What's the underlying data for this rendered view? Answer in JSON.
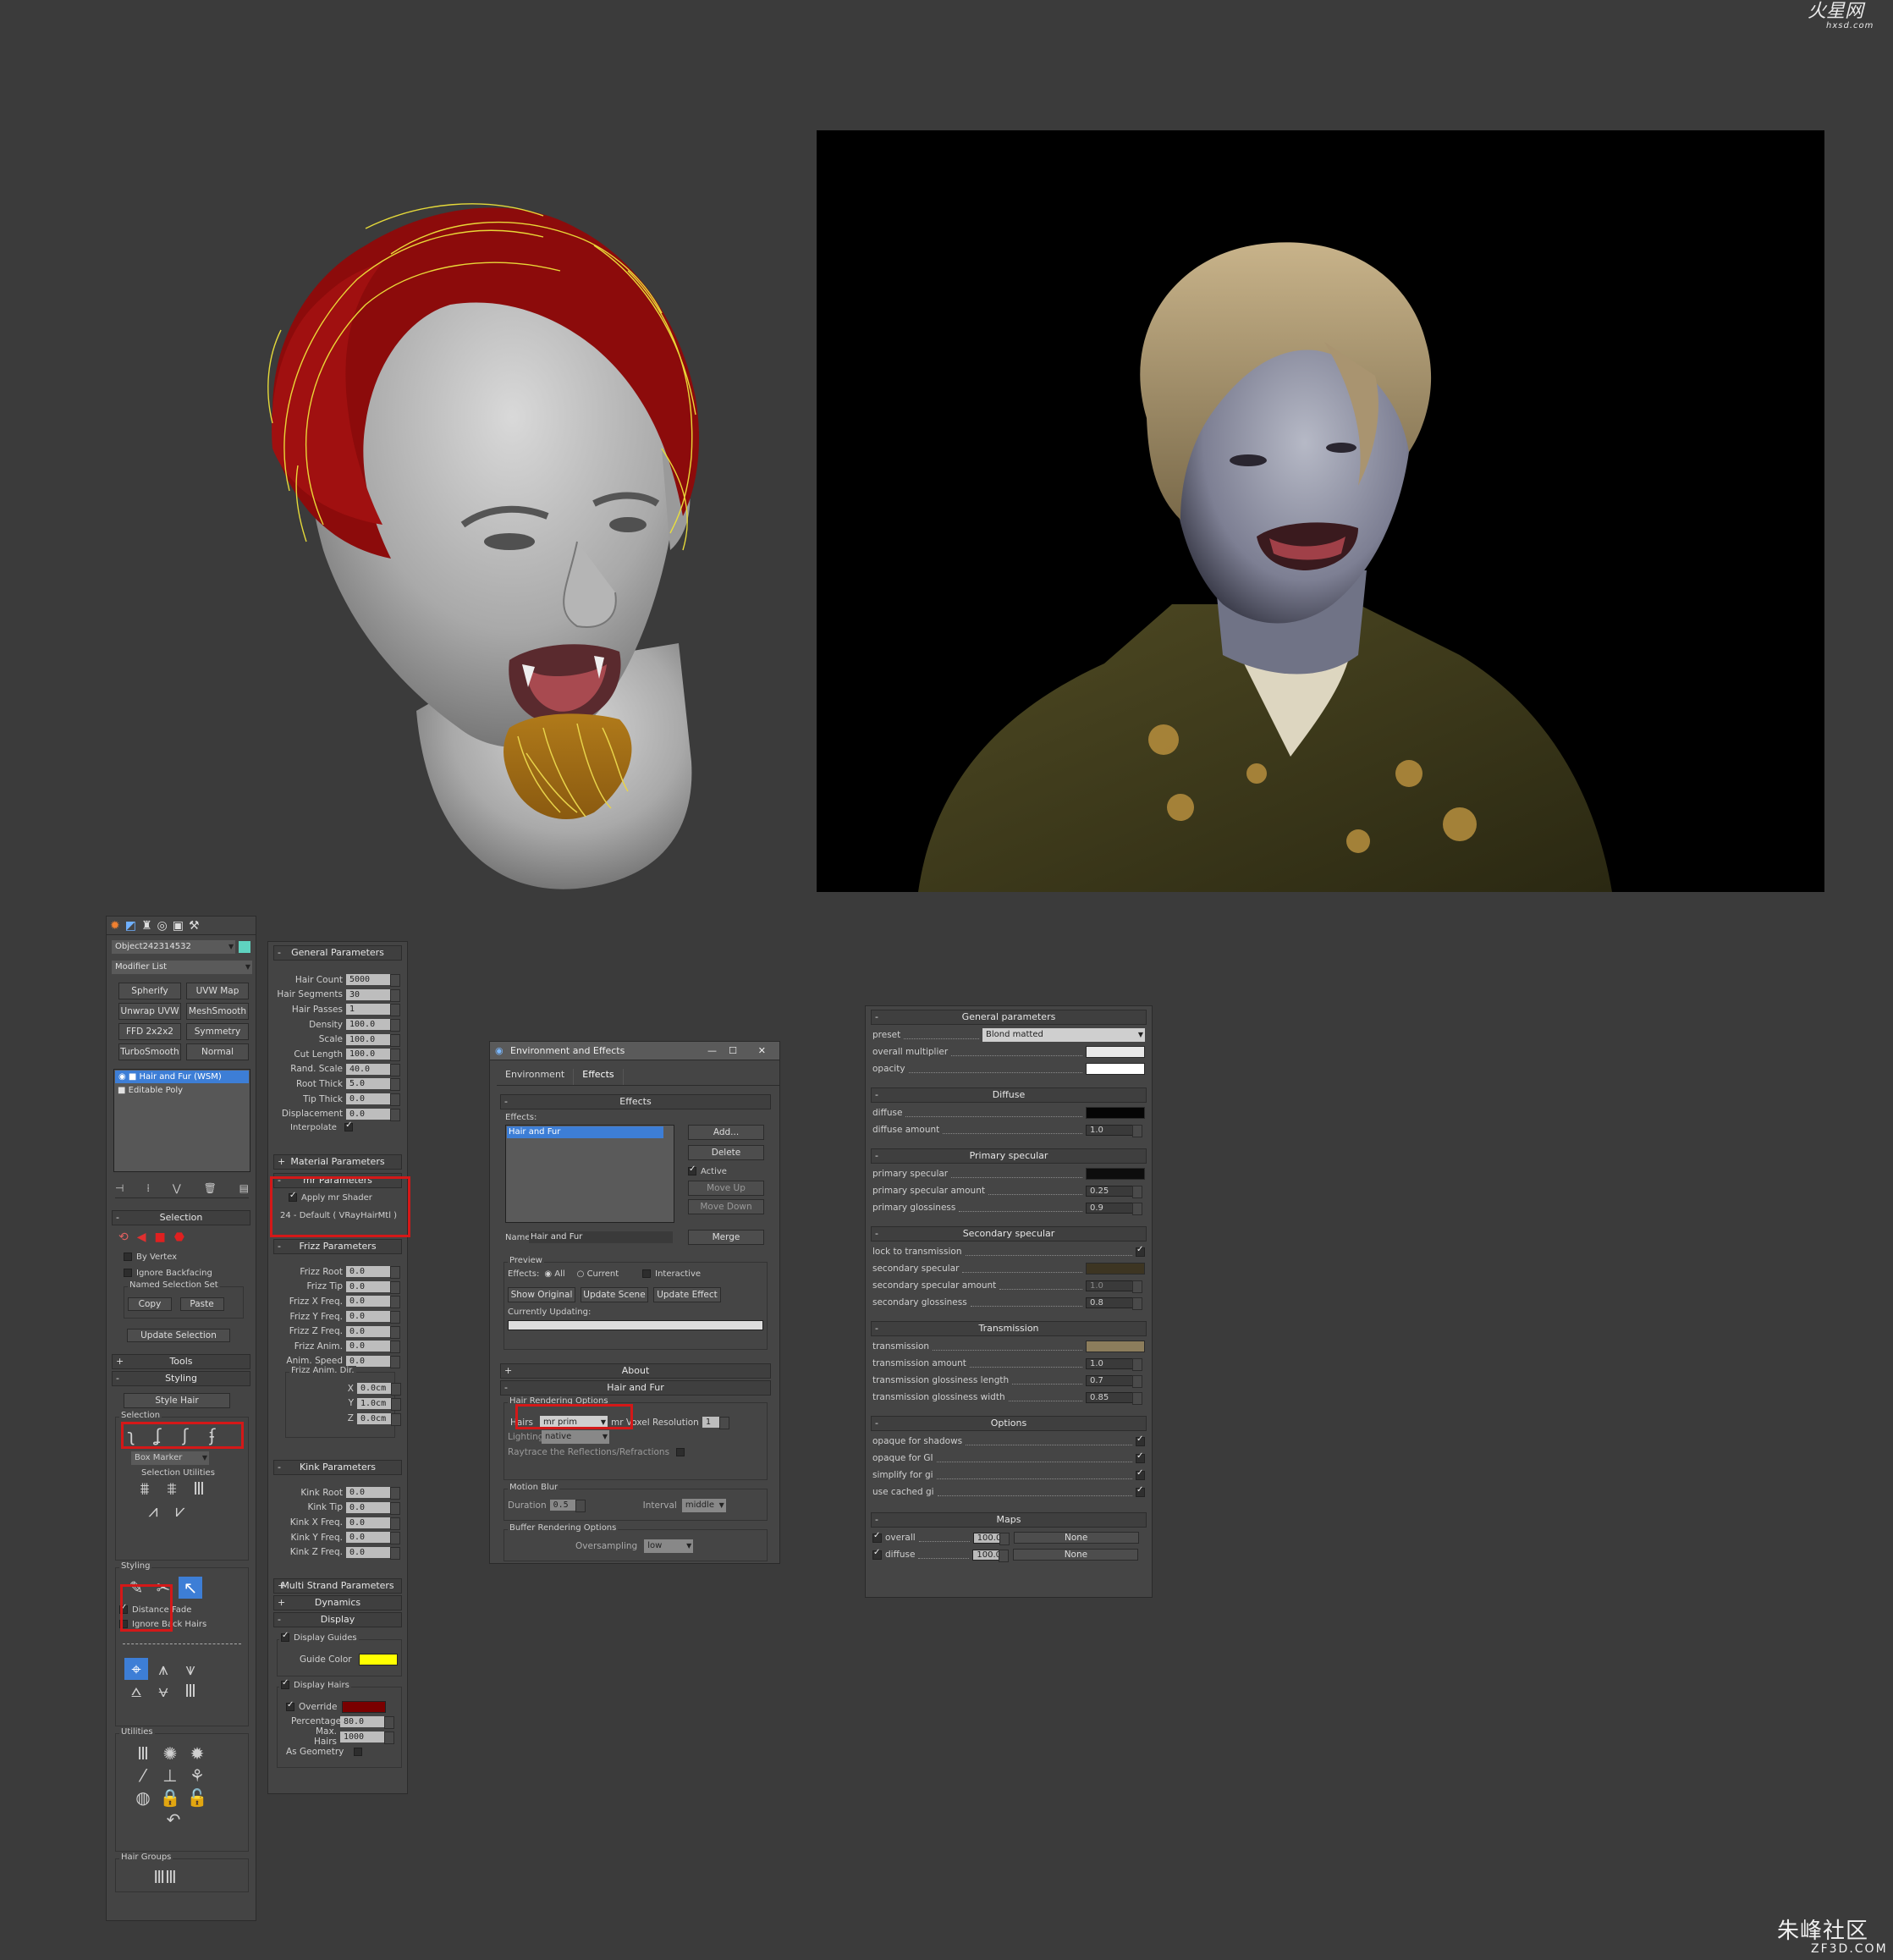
{
  "watermarks": {
    "top_logo": "火星网",
    "top_sub": "hxsd.com",
    "bottom_logo": "朱峰社区",
    "bottom_sub": "ZF3D.COM"
  },
  "command_panel": {
    "object_name": "Object242314532",
    "modifier_list": "Modifier List",
    "modifier_buttons": [
      "Spherify",
      "UVW Map",
      "Unwrap UVW",
      "MeshSmooth",
      "FFD 2x2x2",
      "Symmetry",
      "TurboSmooth",
      "Normal"
    ],
    "stack": [
      "Hair and Fur (WSM)",
      "Editable Poly"
    ],
    "selection": {
      "title": "Selection",
      "by_vertex": "By Vertex",
      "ignore_backfacing": "Ignore Backfacing",
      "named_set": "Named Selection Set",
      "copy": "Copy",
      "paste": "Paste",
      "update_selection": "Update Selection"
    },
    "tools": "Tools",
    "styling": {
      "title": "Styling",
      "style_hair": "Style Hair",
      "selection_label": "Selection",
      "marker": "Box Marker",
      "utilities_label": "Selection Utilities",
      "styling_label": "Styling",
      "distance_fade": "Distance Fade",
      "ignore_back_hairs": "Ignore Back Hairs",
      "utilities": "Utilities",
      "hair_groups": "Hair Groups"
    }
  },
  "params": {
    "general": {
      "title": "General Parameters",
      "rows": [
        {
          "label": "Hair Count",
          "value": "5000"
        },
        {
          "label": "Hair Segments",
          "value": "30"
        },
        {
          "label": "Hair Passes",
          "value": "1"
        },
        {
          "label": "Density",
          "value": "100.0"
        },
        {
          "label": "Scale",
          "value": "100.0"
        },
        {
          "label": "Cut Length",
          "value": "100.0"
        },
        {
          "label": "Rand. Scale",
          "value": "40.0"
        },
        {
          "label": "Root Thick",
          "value": "5.0"
        },
        {
          "label": "Tip Thick",
          "value": "0.0"
        },
        {
          "label": "Displacement",
          "value": "0.0"
        }
      ],
      "interpolate": "Interpolate"
    },
    "material": "Material Parameters",
    "mr": {
      "title": "mr Parameters",
      "apply": "Apply mr Shader",
      "shader": "24 - Default  ( VRayHairMtl )"
    },
    "frizz": {
      "title": "Frizz Parameters",
      "rows": [
        {
          "label": "Frizz Root",
          "value": "0.0"
        },
        {
          "label": "Frizz Tip",
          "value": "0.0"
        },
        {
          "label": "Frizz X Freq.",
          "value": "0.0"
        },
        {
          "label": "Frizz Y Freq.",
          "value": "0.0"
        },
        {
          "label": "Frizz Z Freq.",
          "value": "0.0"
        },
        {
          "label": "Frizz Anim.",
          "value": "0.0"
        },
        {
          "label": "Anim. Speed",
          "value": "0.0"
        }
      ],
      "dir_label": "Frizz Anim. Dir.",
      "dir": [
        {
          "label": "X",
          "value": "0.0cm"
        },
        {
          "label": "Y",
          "value": "1.0cm"
        },
        {
          "label": "Z",
          "value": "0.0cm"
        }
      ]
    },
    "kink": {
      "title": "Kink Parameters",
      "rows": [
        {
          "label": "Kink Root",
          "value": "0.0"
        },
        {
          "label": "Kink Tip",
          "value": "0.0"
        },
        {
          "label": "Kink X Freq.",
          "value": "0.0"
        },
        {
          "label": "Kink Y Freq.",
          "value": "0.0"
        },
        {
          "label": "Kink Z Freq.",
          "value": "0.0"
        }
      ]
    },
    "multi": "Multi Strand Parameters",
    "dynamics": "Dynamics",
    "display": {
      "title": "Display",
      "display_guides": "Display Guides",
      "guide_color": "Guide Color",
      "guide_color_hex": "#ffff00",
      "display_hairs": "Display Hairs",
      "override": "Override",
      "override_hex": "#7a0000",
      "percentage_label": "Percentage",
      "percentage": "80.0",
      "max_hairs_label": "Max. Hairs",
      "max_hairs": "1000",
      "as_geometry": "As Geometry"
    }
  },
  "env": {
    "title": "Environment and Effects",
    "tabs": [
      "Environment",
      "Effects"
    ],
    "effects_title": "Effects",
    "effects_label": "Effects:",
    "effects_list": [
      "Hair and Fur"
    ],
    "buttons": [
      "Add...",
      "Delete",
      "Move Up",
      "Move Down",
      "Merge"
    ],
    "active": "Active",
    "name_label": "Name:",
    "name_value": "Hair and Fur",
    "preview": "Preview",
    "effects_radio_label": "Effects:",
    "all": "All",
    "current": "Current",
    "interactive": "Interactive",
    "show_original": "Show Original",
    "update_scene": "Update Scene",
    "update_effect": "Update Effect",
    "currently_updating": "Currently Updating:",
    "about": "About",
    "hair_and_fur": "Hair and Fur",
    "hro": "Hair Rendering Options",
    "hairs_label": "Hairs",
    "hairs_value": "mr prim",
    "voxel": "mr Voxel Resolution",
    "voxel_value": "1",
    "lighting_label": "Lighting",
    "lighting_value": "native",
    "raytrace": "Raytrace the Reflections/Refractions",
    "motion_blur": "Motion Blur",
    "duration_label": "Duration",
    "duration_value": "0.5",
    "interval_label": "Interval",
    "interval_value": "middle",
    "buffer": "Buffer Rendering Options",
    "oversampling_label": "Oversampling",
    "oversampling_value": "low"
  },
  "shader": {
    "general": "General parameters",
    "preset_label": "preset",
    "preset_value": "Blond matted",
    "overall_multiplier": "overall multiplier",
    "opacity": "opacity",
    "diffuse_title": "Diffuse",
    "diffuse": "diffuse",
    "diffuse_amount": "diffuse amount",
    "diffuse_amount_value": "1.0",
    "primary_title": "Primary specular",
    "primary_specular": "primary specular",
    "primary_amount": "primary specular amount",
    "primary_amount_value": "0.25",
    "primary_gloss": "primary glossiness",
    "primary_gloss_value": "0.9",
    "secondary_title": "Secondary specular",
    "lock": "lock to transmission",
    "secondary_specular": "secondary specular",
    "secondary_amount": "secondary specular amount",
    "secondary_amount_value": "1.0",
    "secondary_gloss": "secondary glossiness",
    "secondary_gloss_value": "0.8",
    "transmission_title": "Transmission",
    "transmission": "transmission",
    "transmission_amount": "transmission amount",
    "transmission_amount_value": "1.0",
    "tgl": "transmission glossiness length",
    "tgl_value": "0.7",
    "tgw": "transmission glossiness width",
    "tgw_value": "0.85",
    "options_title": "Options",
    "options": [
      "opaque for shadows",
      "opaque for GI",
      "simplify for gi",
      "use cached gi"
    ],
    "maps_title": "Maps",
    "maps": [
      {
        "label": "overall",
        "value": "100.0",
        "map": "None"
      },
      {
        "label": "diffuse",
        "value": "100.0",
        "map": "None"
      }
    ],
    "colors": {
      "overall": "#e8e8e8",
      "opacity": "#ffffff",
      "diffuse": "#050505",
      "primary": "#0d0d0d",
      "secondary": "#3d3522",
      "transmission": "#8c7d5c"
    }
  }
}
